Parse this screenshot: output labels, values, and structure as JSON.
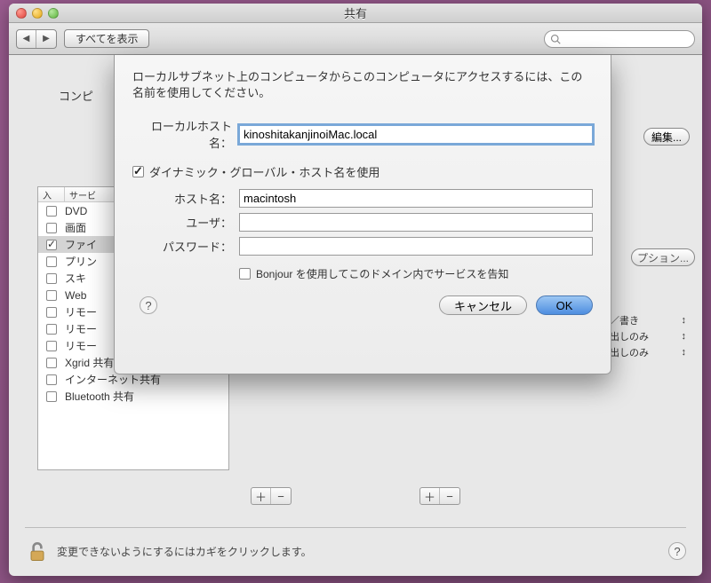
{
  "window": {
    "title": "共有"
  },
  "toolbar": {
    "show_all": "すべてを表示",
    "search_placeholder": ""
  },
  "bg": {
    "computer_label": "コンピ",
    "edit_button": "編集...",
    "options_button": "プション..."
  },
  "list": {
    "col_on": "入",
    "col_service": "サービ",
    "rows": [
      {
        "checked": false,
        "label": "DVD"
      },
      {
        "checked": false,
        "label": "画面"
      },
      {
        "checked": true,
        "label": "ファイ"
      },
      {
        "checked": false,
        "label": "プリン"
      },
      {
        "checked": false,
        "label": "スキ"
      },
      {
        "checked": false,
        "label": "Web"
      },
      {
        "checked": false,
        "label": "リモー"
      },
      {
        "checked": false,
        "label": "リモー"
      },
      {
        "checked": false,
        "label": "リモー"
      },
      {
        "checked": false,
        "label": "Xgrid 共有"
      },
      {
        "checked": false,
        "label": "インターネット共有"
      },
      {
        "checked": false,
        "label": "Bluetooth 共有"
      }
    ]
  },
  "perm": {
    "rows": [
      "／書き",
      "出しのみ",
      "出しのみ"
    ],
    "arrows": "↕"
  },
  "lock": {
    "text": "変更できないようにするにはカギをクリックします。"
  },
  "sheet": {
    "description": "ローカルサブネット上のコンピュータからこのコンピュータにアクセスするには、この名前を使用してください。",
    "local_hostname_label": "ローカルホスト名：",
    "local_hostname_value": "kinoshitakanjinoiMac.local",
    "dynamic_checkbox_label": "ダイナミック・グローバル・ホスト名を使用",
    "dynamic_checked": true,
    "hostname_label": "ホスト名：",
    "hostname_value": "macintosh",
    "user_label": "ユーザ：",
    "user_value": "",
    "password_label": "パスワード：",
    "password_value": "",
    "bonjour_checkbox_label": "Bonjour を使用してこのドメイン内でサービスを告知",
    "bonjour_checked": false,
    "cancel": "キャンセル",
    "ok": "OK"
  },
  "icons": {
    "plus": "＋",
    "minus": "−",
    "help": "?"
  }
}
